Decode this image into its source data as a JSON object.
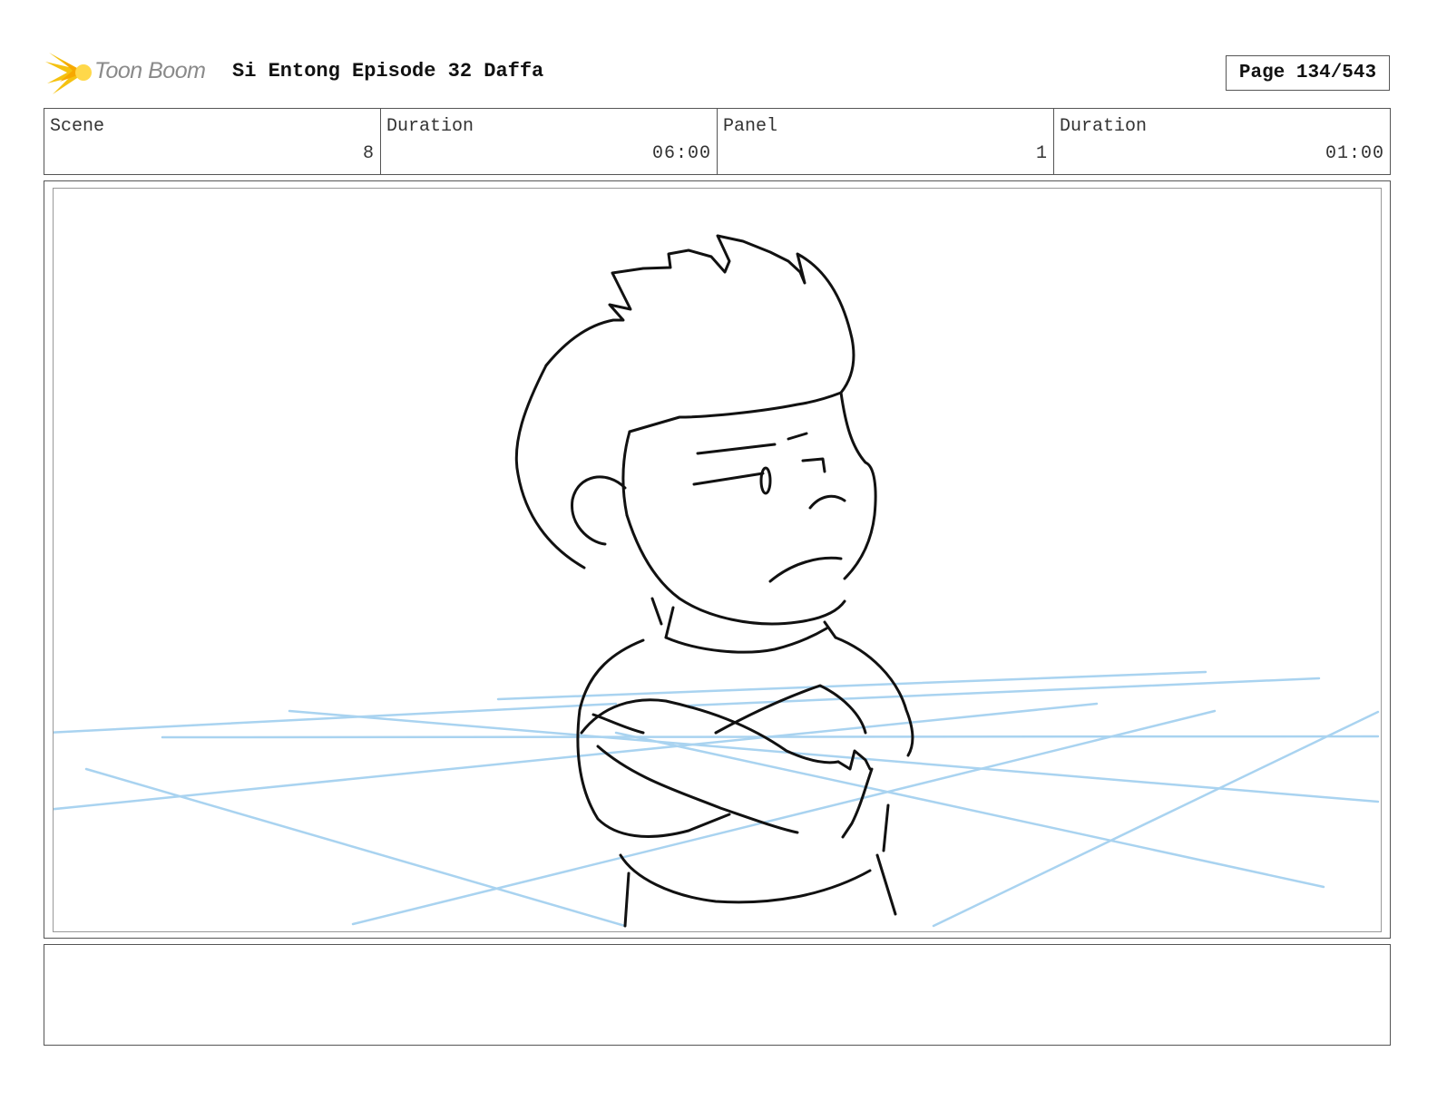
{
  "header": {
    "logo_text": "Toon Boom",
    "title": "Si Entong Episode 32 Daffa",
    "page_label": "Page 134/543"
  },
  "info": {
    "scene_label": "Scene",
    "scene_value": "8",
    "scene_duration_label": "Duration",
    "scene_duration_value": "06:00",
    "panel_label": "Panel",
    "panel_value": "1",
    "panel_duration_label": "Duration",
    "panel_duration_value": "01:00"
  },
  "colors": {
    "sketch_line": "#111111",
    "floor_guides": "#a9d3f0",
    "logo_accent": "#f5c211"
  }
}
